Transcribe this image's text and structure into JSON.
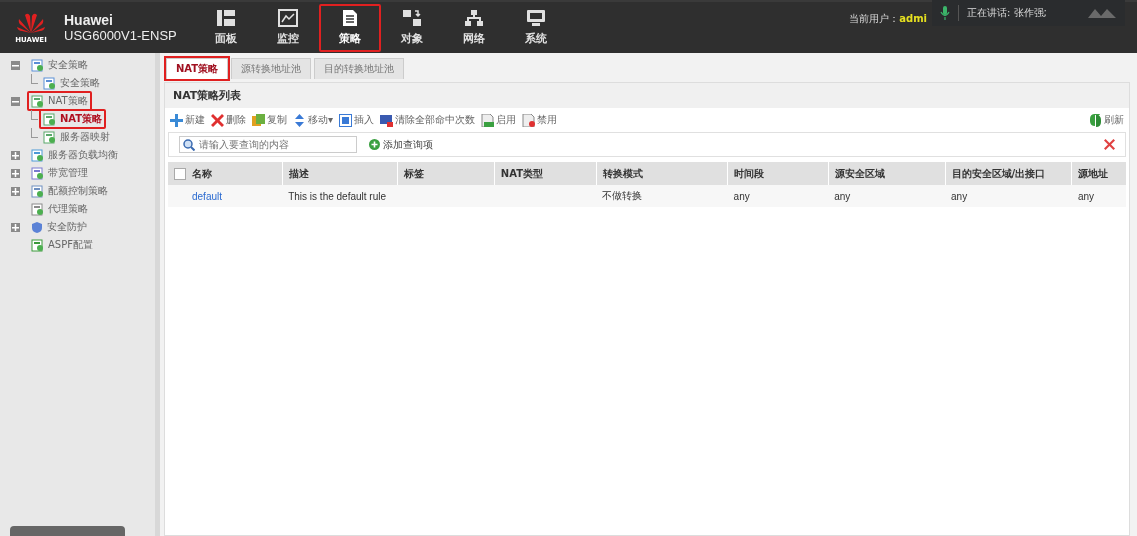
{
  "brand": {
    "logo_text": "HUAWEI",
    "title": "Huawei",
    "model": "USG6000V1-ENSP"
  },
  "nav": [
    {
      "label": "面板",
      "selected": false,
      "highlighted": false
    },
    {
      "label": "监控",
      "selected": false,
      "highlighted": false
    },
    {
      "label": "策略",
      "selected": true,
      "highlighted": true
    },
    {
      "label": "对象",
      "selected": false,
      "highlighted": false
    },
    {
      "label": "网络",
      "selected": false,
      "highlighted": false
    },
    {
      "label": "系统",
      "selected": false,
      "highlighted": false
    }
  ],
  "user": {
    "label": "当前用户：",
    "name": "admi"
  },
  "speaking_overlay": {
    "text": "正在讲话: 张作强;"
  },
  "sidebar": {
    "items": [
      {
        "label": "安全策略",
        "expanded": true,
        "selected": false,
        "highlighted": false,
        "children": [
          {
            "label": "安全策略",
            "selected": false,
            "highlighted": false
          }
        ]
      },
      {
        "label": "NAT策略",
        "expanded": true,
        "selected": false,
        "highlighted": true,
        "children": [
          {
            "label": "NAT策略",
            "selected": true,
            "highlighted": true
          },
          {
            "label": "服务器映射",
            "selected": false,
            "highlighted": false
          }
        ]
      },
      {
        "label": "服务器负载均衡",
        "expanded": false,
        "selected": false,
        "highlighted": false
      },
      {
        "label": "带宽管理",
        "expanded": false,
        "selected": false,
        "highlighted": false
      },
      {
        "label": "配额控制策略",
        "expanded": false,
        "selected": false,
        "highlighted": false
      },
      {
        "label": "代理策略",
        "selected": false,
        "highlighted": false
      },
      {
        "label": "安全防护",
        "expanded": false,
        "selected": false,
        "highlighted": false
      },
      {
        "label": "ASPF配置",
        "selected": false,
        "highlighted": false
      }
    ]
  },
  "tabs": [
    {
      "label": "NAT策略",
      "selected": true,
      "highlighted": true
    },
    {
      "label": "源转换地址池",
      "selected": false,
      "highlighted": false
    },
    {
      "label": "目的转换地址池",
      "selected": false,
      "highlighted": false
    }
  ],
  "panel_title": "NAT策略列表",
  "toolbar": [
    {
      "label": "新建"
    },
    {
      "label": "删除"
    },
    {
      "label": "复制"
    },
    {
      "label": "移动▾"
    },
    {
      "label": "插入"
    },
    {
      "label": "清除全部命中次数"
    },
    {
      "label": "启用"
    },
    {
      "label": "禁用"
    }
  ],
  "refresh": "刷新",
  "search": {
    "placeholder": "请输入要查询的内容",
    "add_query": "添加查询项"
  },
  "table": {
    "columns": [
      "名称",
      "描述",
      "标签",
      "NAT类型",
      "转换模式",
      "时间段",
      "源安全区域",
      "目的安全区域/出接口",
      "源地址"
    ],
    "select_all_checked": false,
    "rows": [
      {
        "cells": [
          "default",
          "This is the default rule",
          "",
          "",
          "不做转换",
          "any",
          "any",
          "any",
          "any"
        ]
      }
    ]
  }
}
